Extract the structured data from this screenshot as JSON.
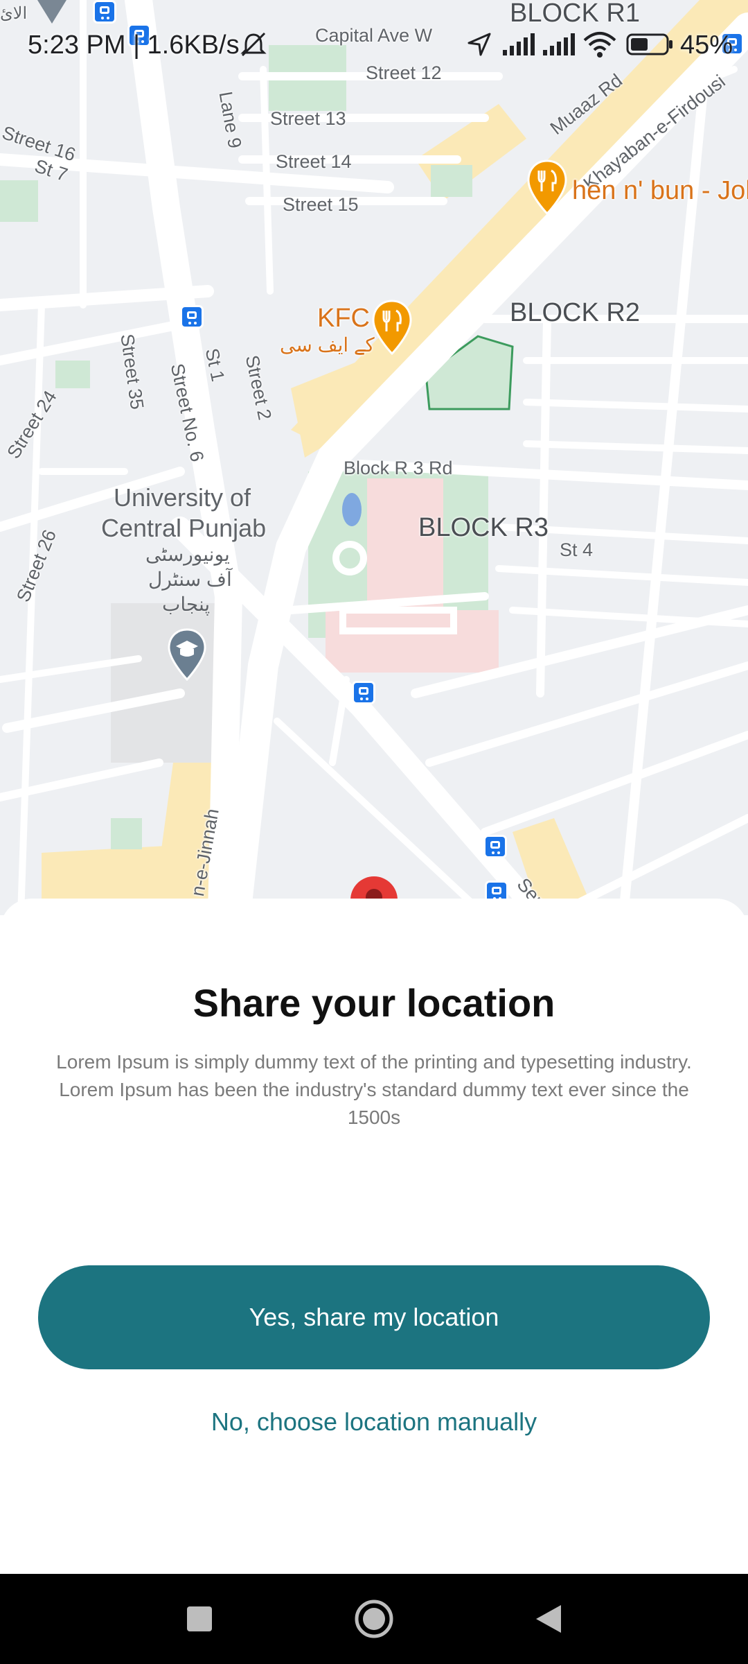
{
  "status_bar": {
    "time": "5:23 PM | 1.6KB/s",
    "battery": "45%"
  },
  "map": {
    "labels": {
      "capital_ave": "Capital Ave W",
      "street12": "Street 12",
      "street13": "Street 13",
      "street14": "Street 14",
      "street15": "Street 15",
      "street16": "Street 16",
      "st7": "St 7",
      "lane9": "Lane 9",
      "muaaz": "Muaaz Rd",
      "khayaban": "Khayaban-e-Firdousi",
      "block_r1": "BLOCK R1",
      "block_r2": "BLOCK R2",
      "block_r3": "BLOCK R3",
      "block_r3_rd": "Block R 3 Rd",
      "st4": "St 4",
      "chicken": "hen n' bun - Joh",
      "kfc": "KFC",
      "kfc_urdu": "کے ایف سی",
      "street35": "Street 35",
      "street24": "Street 24",
      "street_no6": "Street No. 6",
      "st1": "St 1",
      "street2": "Street 2",
      "street26": "Street 26",
      "ucp_line1": "University of",
      "ucp_line2": "Central Punjab",
      "ucp_urdu1": "یونیورسٹی",
      "ucp_urdu2": "آف سنٹرل",
      "ucp_urdu3": "پنجاب",
      "jinnah": "n-e-Jinnah",
      "ser": "Ser",
      "top_left": "الائ"
    }
  },
  "sheet": {
    "title": "Share your location",
    "description": "Lorem Ipsum is simply dummy text of the printing and typesetting industry. Lorem Ipsum has been the industry's standard dummy text ever since the 1500s",
    "primary_button": "Yes, share my location",
    "secondary_link": "No, choose location manually"
  },
  "colors": {
    "accent": "#1c7480",
    "map_background": "#eef0f3",
    "food_poi": "#f29900"
  },
  "icons": {
    "nav_recent": "square-icon",
    "nav_home": "circle-home-icon",
    "nav_back": "triangle-back-icon"
  }
}
